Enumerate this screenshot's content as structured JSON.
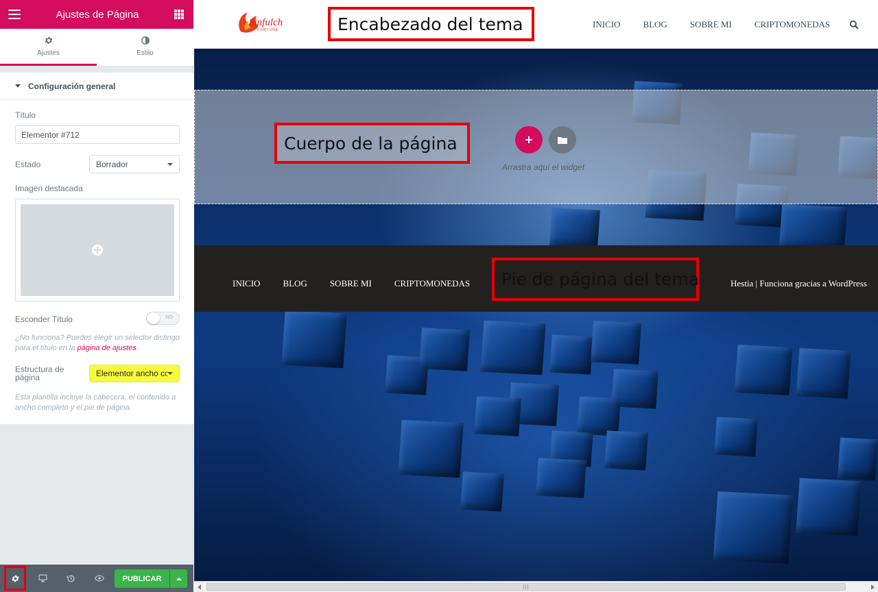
{
  "panel": {
    "title": "Ajustes de Página",
    "tabs": [
      {
        "label": "Ajustes",
        "icon": "gear-icon",
        "active": true
      },
      {
        "label": "Estilo",
        "icon": "contrast-icon",
        "active": false
      }
    ],
    "section_title": "Configuración general",
    "fields": {
      "title_label": "Título",
      "title_value": "Elementor #712",
      "status_label": "Estado",
      "status_value": "Borrador",
      "featured_label": "Imagen destacada",
      "hide_title_label": "Esconder Título",
      "hide_title_state": "NO",
      "help_prefix": "¿No funciona? Puedes elegir un selector distingo para el título en la",
      "help_link": "página de ajustes",
      "help_suffix": ".",
      "layout_label_line1": "Estructura de",
      "layout_label_line2": "página",
      "layout_value": "Elementor ancho co",
      "layout_help": "Esta plantilla incluye la cabecera, el contenido a ancho completo y el pie de página."
    },
    "bottom": {
      "publish_label": "PUBLICAR",
      "icons": [
        "gear-icon",
        "desktop-icon",
        "history-icon",
        "eye-icon"
      ]
    }
  },
  "site": {
    "header_annotation": "Encabezado del tema",
    "nav": [
      "INICIO",
      "BLOG",
      "SOBRE MI",
      "CRIPTOMONEDAS"
    ],
    "body_annotation": "Cuerpo de la página",
    "drag_hint": "Arrastra aquí el widget",
    "footer_annotation": "Pie de página del tema",
    "footer_nav": [
      "INICIO",
      "BLOG",
      "SOBRE MI",
      "CRIPTOMONEDAS"
    ],
    "credit_theme": "Hestia |",
    "credit_powered": "Funciona gracias a WordPress"
  },
  "colors": {
    "brand": "#d30c5c",
    "publish": "#39b54a",
    "annotation": "#e80000",
    "highlight": "#f6fb3a"
  }
}
